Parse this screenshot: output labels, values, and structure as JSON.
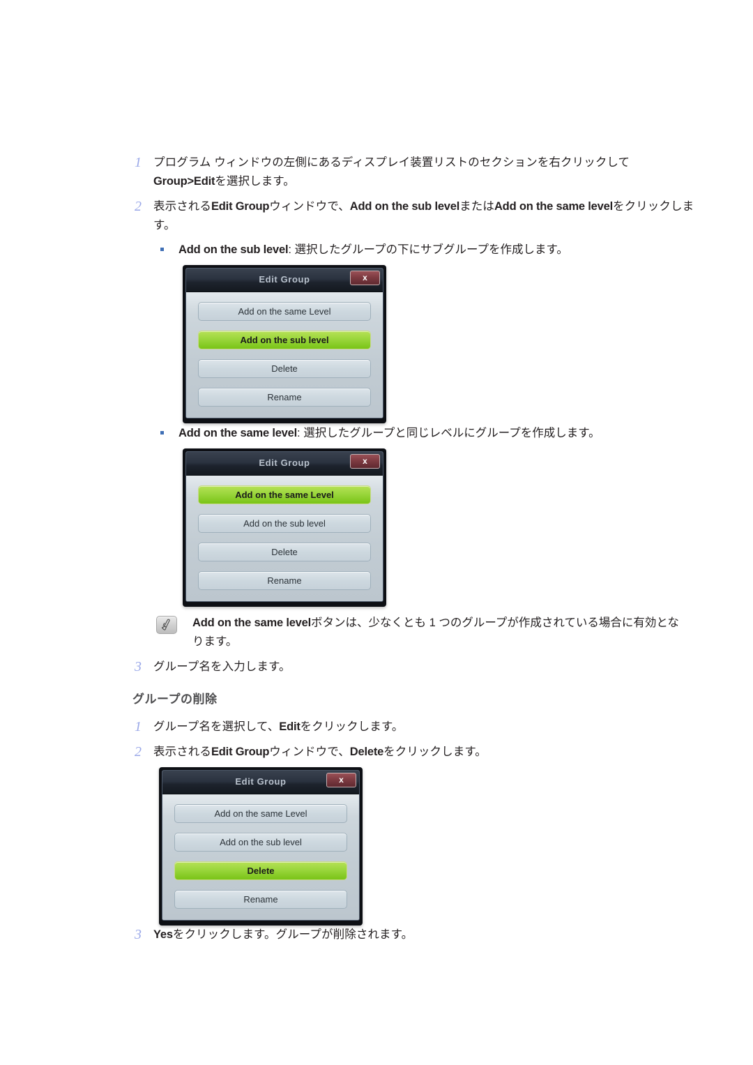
{
  "steps_create": [
    {
      "num": "1",
      "line1_pre": "プログラム ウィンドウの左側にあるディスプレイ装置リストのセクションを右クリックして",
      "line2_en": "Group>Edit",
      "line2_post": "を選択します。"
    },
    {
      "num": "2",
      "pre": "表示される",
      "en1": "Edit Group",
      "mid1": "ウィンドウで、",
      "en2": "Add on the sub level",
      "mid2": "または",
      "en3": "Add on the same level",
      "post": "をクリックします。"
    },
    {
      "num": "3",
      "text": "グループ名を入力します。"
    }
  ],
  "bullets": [
    {
      "en": "Add on the sub level",
      "jp": ": 選択したグループの下にサブグループを作成します。"
    },
    {
      "en": "Add on the same level",
      "jp": ": 選択したグループと同じレベルにグループを作成します。"
    }
  ],
  "note": {
    "icon": "note-pencil-icon",
    "en": "Add on the same level",
    "line1": "ボタンは、少なくとも 1 つのグループが作成されている場合に有効とな",
    "line2": "ります。"
  },
  "section_delete": {
    "heading": "グループの削除",
    "steps": [
      {
        "num": "1",
        "pre": "グループ名を選択して、",
        "en": "Edit",
        "post": "をクリックします。"
      },
      {
        "num": "2",
        "pre": "表示される",
        "en1": "Edit Group",
        "mid": "ウィンドウで、",
        "en2": "Delete",
        "post": "をクリックします。"
      },
      {
        "num": "3",
        "en": "Yes",
        "post": "をクリックします。グループが削除されます。"
      }
    ]
  },
  "dialogs": [
    {
      "title": "Edit Group",
      "close_label": "x",
      "buttons": [
        {
          "label": "Add on the same Level",
          "selected": false
        },
        {
          "label": "Add on the sub level",
          "selected": true
        },
        {
          "label": "Delete",
          "selected": false
        },
        {
          "label": "Rename",
          "selected": false
        }
      ]
    },
    {
      "title": "Edit Group",
      "close_label": "x",
      "buttons": [
        {
          "label": "Add on the same Level",
          "selected": true
        },
        {
          "label": "Add on the sub level",
          "selected": false
        },
        {
          "label": "Delete",
          "selected": false
        },
        {
          "label": "Rename",
          "selected": false
        }
      ]
    },
    {
      "title": "Edit Group",
      "close_label": "x",
      "buttons": [
        {
          "label": "Add on the same Level",
          "selected": false
        },
        {
          "label": "Add on the sub level",
          "selected": false
        },
        {
          "label": "Delete",
          "selected": true
        },
        {
          "label": "Rename",
          "selected": false
        }
      ]
    }
  ],
  "theme": {
    "accent_green": "#9ad63c",
    "step_number_color": "#9aa8e8",
    "bullet_color": "#3f6fb5",
    "heading_color": "#4d4d4f",
    "dialog_title_bg": "#2b3340",
    "close_button_bg": "#7e3b42"
  }
}
